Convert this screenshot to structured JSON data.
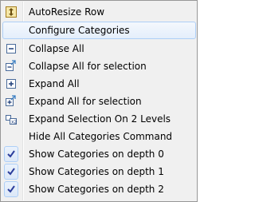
{
  "menu": {
    "items": [
      {
        "label": "AutoResize Row",
        "icon": "autoresize-row-icon",
        "checked": false
      },
      {
        "label": "Configure Categories",
        "icon": "",
        "checked": false,
        "highlighted": true
      },
      {
        "label": "Collapse All",
        "icon": "collapse-all-icon",
        "checked": false
      },
      {
        "label": "Collapse All for selection",
        "icon": "collapse-selection-icon",
        "checked": false
      },
      {
        "label": "Expand All",
        "icon": "expand-all-icon",
        "checked": false
      },
      {
        "label": "Expand All for selection",
        "icon": "expand-selection-icon",
        "checked": false
      },
      {
        "label": "Expand Selection On 2 Levels",
        "icon": "expand-two-levels-icon",
        "checked": false
      },
      {
        "label": "Hide All Categories Command",
        "icon": "",
        "checked": false
      },
      {
        "label": "Show Categories on depth 0",
        "icon": "checkmark-icon",
        "checked": true
      },
      {
        "label": "Show Categories on depth 1",
        "icon": "checkmark-icon",
        "checked": true
      },
      {
        "label": "Show Categories on depth 2",
        "icon": "checkmark-icon",
        "checked": true
      }
    ]
  },
  "colors": {
    "menu_background": "#f0f0f0",
    "highlight_border": "#aecff7",
    "check_color": "#2c3e9c"
  }
}
